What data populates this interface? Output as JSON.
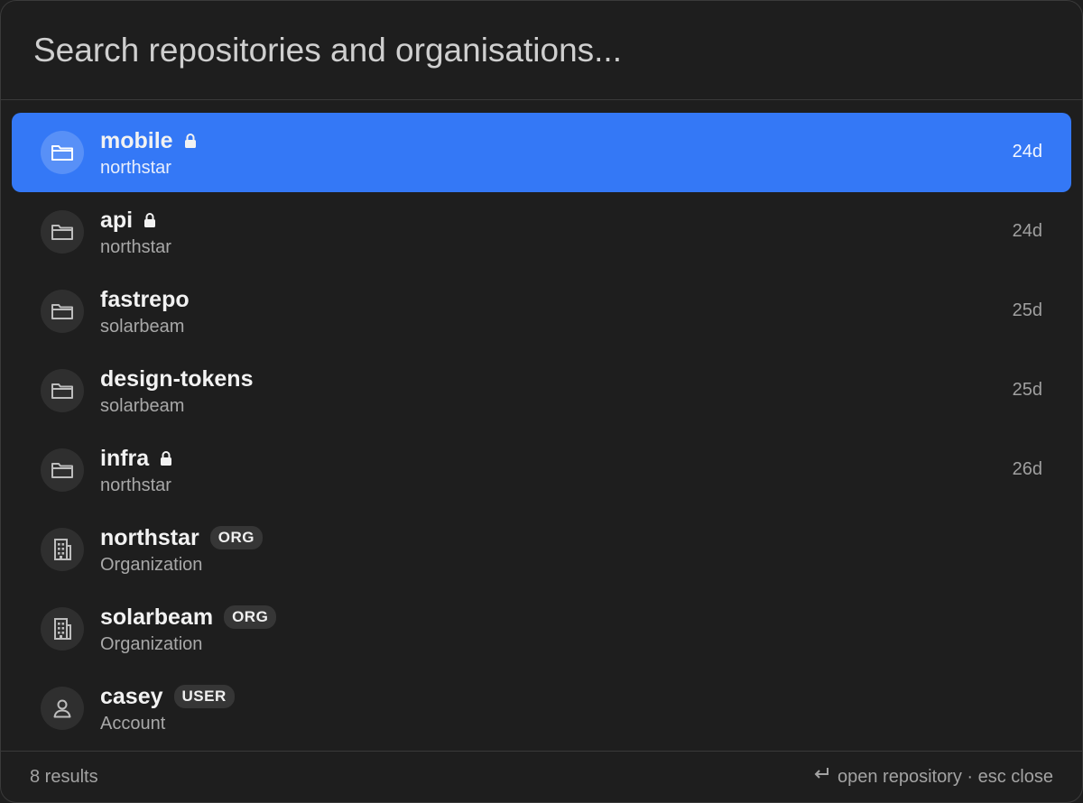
{
  "search": {
    "placeholder": "Search repositories and organisations..."
  },
  "results": [
    {
      "title": "mobile",
      "subtitle": "northstar",
      "age": "24d",
      "locked": true,
      "badge": "",
      "icon": "folder-icon",
      "selected": true
    },
    {
      "title": "api",
      "subtitle": "northstar",
      "age": "24d",
      "locked": true,
      "badge": "",
      "icon": "folder-icon",
      "selected": false
    },
    {
      "title": "fastrepo",
      "subtitle": "solarbeam",
      "age": "25d",
      "locked": false,
      "badge": "",
      "icon": "folder-icon",
      "selected": false
    },
    {
      "title": "design-tokens",
      "subtitle": "solarbeam",
      "age": "25d",
      "locked": false,
      "badge": "",
      "icon": "folder-icon",
      "selected": false
    },
    {
      "title": "infra",
      "subtitle": "northstar",
      "age": "26d",
      "locked": true,
      "badge": "",
      "icon": "folder-icon",
      "selected": false
    },
    {
      "title": "northstar",
      "subtitle": "Organization",
      "age": "",
      "locked": false,
      "badge": "ORG",
      "icon": "building-icon",
      "selected": false
    },
    {
      "title": "solarbeam",
      "subtitle": "Organization",
      "age": "",
      "locked": false,
      "badge": "ORG",
      "icon": "building-icon",
      "selected": false
    },
    {
      "title": "casey",
      "subtitle": "Account",
      "age": "",
      "locked": false,
      "badge": "USER",
      "icon": "person-icon",
      "selected": false
    }
  ],
  "footer": {
    "count": "8 results",
    "hint": "open repository · esc close",
    "hint_icon": "return-key-icon"
  },
  "colors": {
    "accent": "#3478f6",
    "background": "#1e1e1e"
  }
}
